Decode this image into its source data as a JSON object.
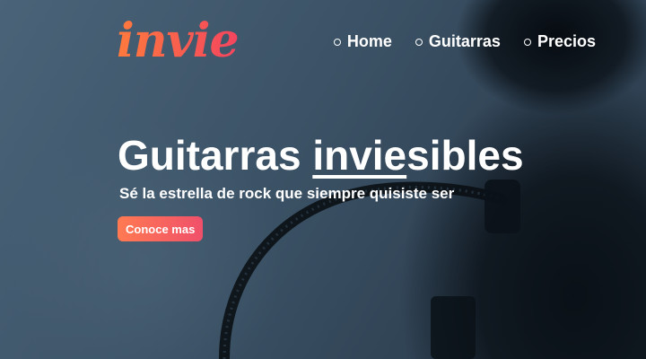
{
  "brand": {
    "logo_text": "invie"
  },
  "nav": {
    "items": [
      {
        "label": "Home"
      },
      {
        "label": "Guitarras"
      },
      {
        "label": "Precios"
      }
    ]
  },
  "hero": {
    "title_prefix": "Guitarras ",
    "title_highlight": "invie",
    "title_suffix": "sibles",
    "subtitle": "Sé la estrella de rock que siempre quisiste ser",
    "cta_label": "Conoce mas"
  },
  "colors": {
    "accent_start": "#ff7a3d",
    "accent_end": "#f4455f",
    "background": "#3b5266",
    "text": "#ffffff"
  }
}
